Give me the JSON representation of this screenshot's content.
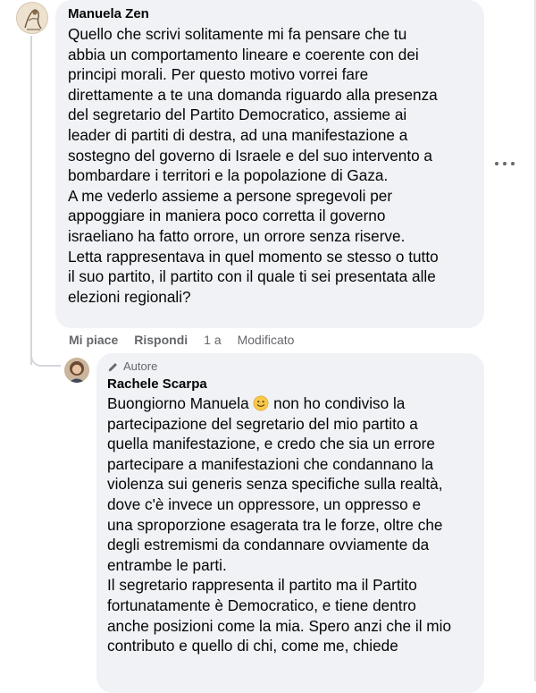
{
  "comment": {
    "author": "Manuela Zen",
    "text": "Quello che scrivi solitamente mi fa pensare che tu\nabbia un comportamento lineare e coerente con dei\nprincipi morali. Per questo motivo vorrei fare\ndirettamente a te una domanda riguardo alla presenza\ndel segretario del Partito Democratico, assieme ai\nleader di partiti di destra, ad una manifestazione a\nsostegno del governo di Israele e del suo intervento a\nbombardare i territori e la popolazione di Gaza.\nA me vederlo assieme a persone spregevoli per\nappoggiare in maniera poco corretta il governo\nisraeliano ha fatto orrore, un orrore senza riserve.\nLetta rappresentava in quel momento se stesso o tutto\nil suo partito, il partito con il quale ti sei presentata alle\nelezioni regionali?",
    "actions": {
      "like": "Mi piace",
      "reply": "Rispondi",
      "time": "1 a",
      "edited": "Modificato"
    },
    "more_icon": "more-horizontal-icon"
  },
  "reply": {
    "badge": "Autore",
    "badge_icon": "pencil-icon",
    "author": "Rachele Scarpa",
    "text_lead": "Buongiorno Manuela ",
    "emoji": "slightly-smiling-face-emoji",
    "text_rest": " non ho condiviso la\npartecipazione del segretario del mio partito a\nquella manifestazione, e credo che sia un errore\npartecipare a manifestazioni che condannano la\nviolenza sui generis senza specifiche sulla realtà,\ndove c'è invece un oppressore, un oppresso e\nuna sproporzione esagerata tra le forze, oltre che\ndegli estremismi da condannare ovviamente da\nentrambe le parti.\nIl segretario rappresenta il partito ma il Partito\nfortunatamente è Democratico, e tiene dentro\nanche posizioni come la mia. Spero anzi che il mio\ncontributo e quello di chi, come me, chiede"
  },
  "colors": {
    "bubble": "#f0f2f5",
    "text": "#050505",
    "meta": "#65676b",
    "thread_line": "#d3d6db"
  }
}
